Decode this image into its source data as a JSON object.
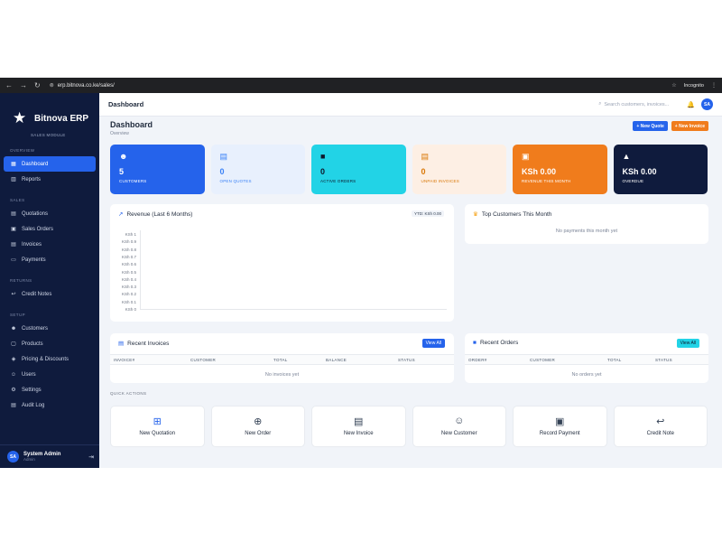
{
  "browser": {
    "url": "erp.bitnova.co.ke/sales/",
    "incognito_label": "Incognito"
  },
  "sidebar": {
    "brand": "Bitnova ERP",
    "module": "SALES MODULE",
    "sections": [
      {
        "title": "OVERVIEW",
        "items": [
          {
            "label": "Dashboard",
            "icon": "grid-icon"
          },
          {
            "label": "Reports",
            "icon": "chart-icon"
          }
        ]
      },
      {
        "title": "SALES",
        "items": [
          {
            "label": "Quotations",
            "icon": "file-icon"
          },
          {
            "label": "Sales Orders",
            "icon": "cart-icon"
          },
          {
            "label": "Invoices",
            "icon": "invoice-icon"
          },
          {
            "label": "Payments",
            "icon": "card-icon"
          }
        ]
      },
      {
        "title": "RETURNS",
        "items": [
          {
            "label": "Credit Notes",
            "icon": "return-icon"
          }
        ]
      },
      {
        "title": "SETUP",
        "items": [
          {
            "label": "Customers",
            "icon": "users-icon"
          },
          {
            "label": "Products",
            "icon": "box-icon"
          },
          {
            "label": "Pricing & Discounts",
            "icon": "tag-icon"
          },
          {
            "label": "Users",
            "icon": "user-icon"
          },
          {
            "label": "Settings",
            "icon": "gear-icon"
          },
          {
            "label": "Audit Log",
            "icon": "log-icon"
          }
        ]
      }
    ],
    "user": {
      "initials": "SA",
      "name": "System Admin",
      "role": "Admin"
    }
  },
  "topbar": {
    "title": "Dashboard",
    "search_placeholder": "Search customers, invoices...",
    "avatar": "SA"
  },
  "page": {
    "title": "Dashboard",
    "subtitle": "Overview",
    "new_quote": "+ New Quote",
    "new_invoice": "+ New Invoice"
  },
  "stats": [
    {
      "value": "5",
      "label": "CUSTOMERS",
      "bg": "#2563eb",
      "fg": "#ffffff",
      "icon": "users-icon"
    },
    {
      "value": "0",
      "label": "OPEN QUOTES",
      "bg": "#e8f0fd",
      "fg": "#3b82f6",
      "icon": "file-icon"
    },
    {
      "value": "0",
      "label": "ACTIVE ORDERS",
      "bg": "#22d3e6",
      "fg": "#0f172a",
      "icon": "bag-icon"
    },
    {
      "value": "0",
      "label": "UNPAID INVOICES",
      "bg": "#fdefe4",
      "fg": "#d97706",
      "icon": "invoice-icon"
    },
    {
      "value": "KSh 0.00",
      "label": "REVENUE THIS MONTH",
      "bg": "#f07c1c",
      "fg": "#ffffff",
      "icon": "money-icon"
    },
    {
      "value": "KSh 0.00",
      "label": "OVERDUE",
      "bg": "#0f1b3d",
      "fg": "#ffffff",
      "icon": "warning-icon"
    }
  ],
  "revenue": {
    "title": "Revenue (Last 6 Months)",
    "ytd": "YTD: KSh 0.00",
    "yticks": [
      "KSh 1",
      "KSh 0.9",
      "KSh 0.8",
      "KSh 0.7",
      "KSh 0.6",
      "KSh 0.5",
      "KSh 0.4",
      "KSh 0.3",
      "KSh 0.2",
      "KSh 0.1",
      "KSh 0"
    ]
  },
  "top_customers": {
    "title": "Top Customers This Month",
    "empty": "No payments this month yet"
  },
  "recent_invoices": {
    "title": "Recent Invoices",
    "view_all": "View All",
    "columns": [
      "INVOICE#",
      "CUSTOMER",
      "TOTAL",
      "BALANCE",
      "STATUS"
    ],
    "empty": "No invoices yet"
  },
  "recent_orders": {
    "title": "Recent Orders",
    "view_all": "View All",
    "columns": [
      "ORDER#",
      "CUSTOMER",
      "TOTAL",
      "STATUS"
    ],
    "empty": "No orders yet"
  },
  "quick_actions": {
    "title": "QUICK ACTIONS",
    "items": [
      {
        "label": "New Quotation",
        "icon": "doc-plus-icon"
      },
      {
        "label": "New Order",
        "icon": "bag-plus-icon"
      },
      {
        "label": "New Invoice",
        "icon": "invoice-icon"
      },
      {
        "label": "New Customer",
        "icon": "user-plus-icon"
      },
      {
        "label": "Record Payment",
        "icon": "money-icon"
      },
      {
        "label": "Credit Note",
        "icon": "return-icon"
      }
    ]
  }
}
